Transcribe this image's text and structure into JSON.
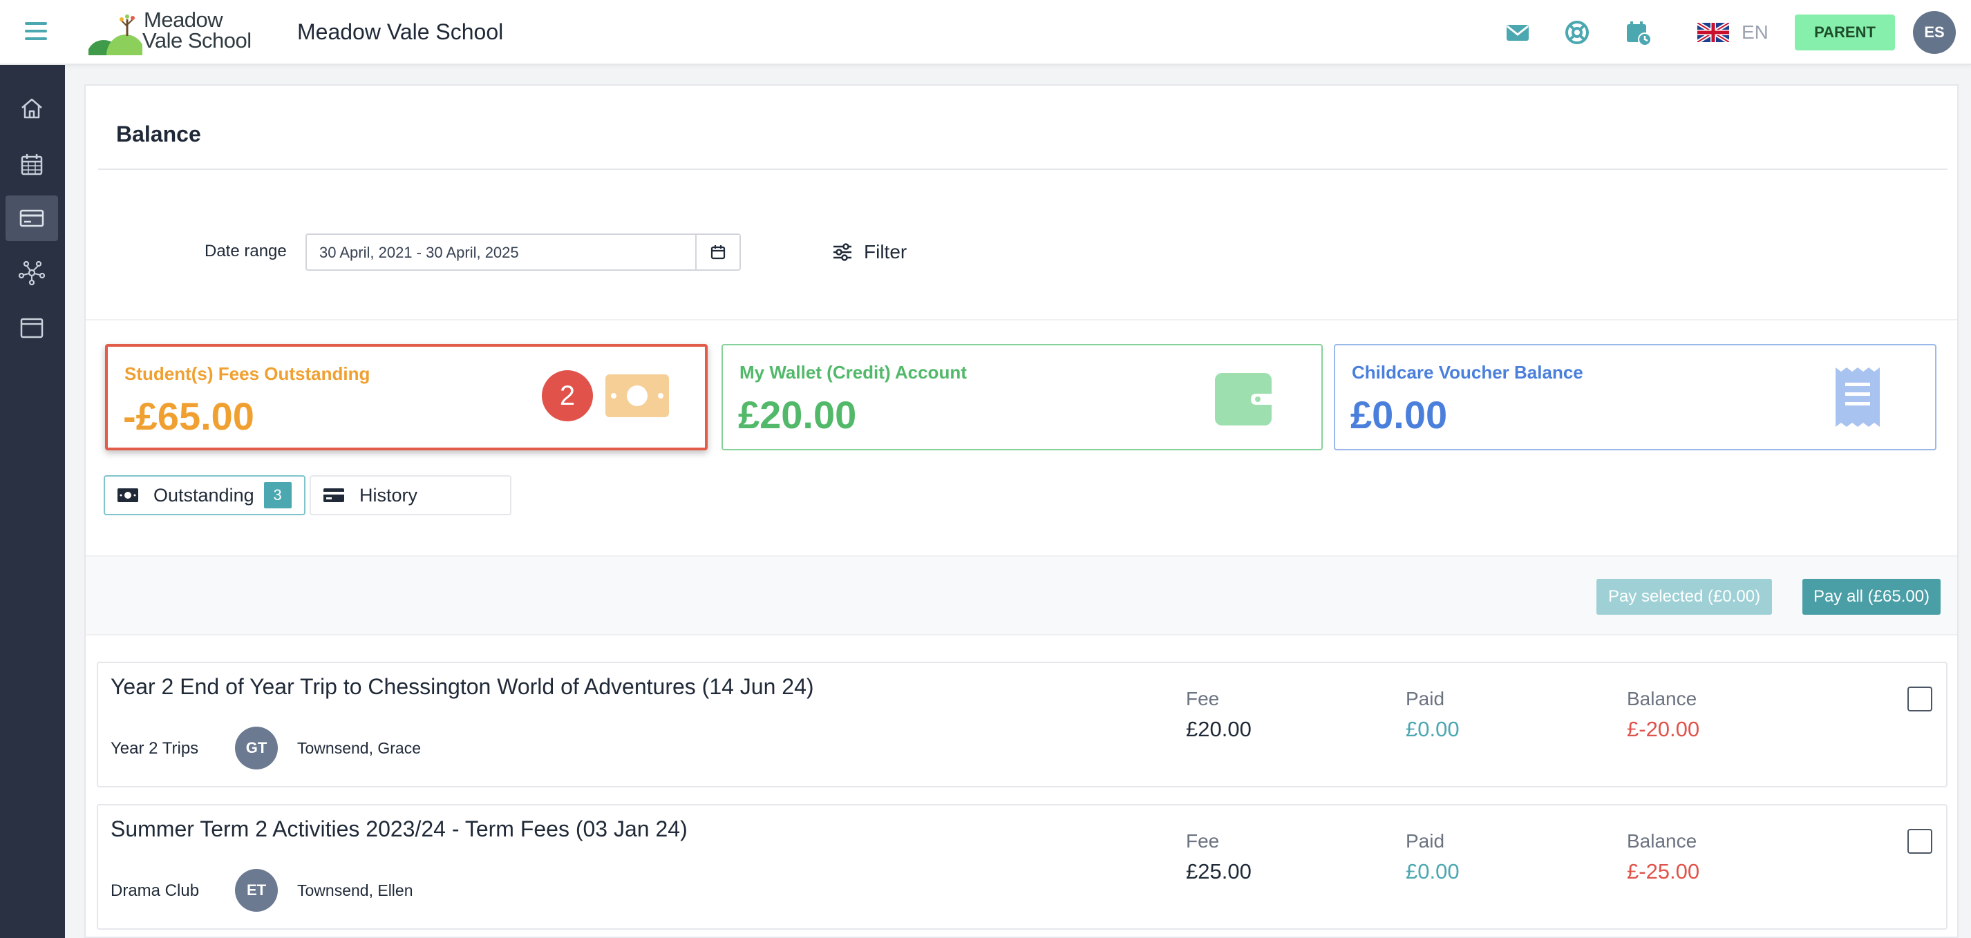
{
  "header": {
    "logo_line1": "Meadow",
    "logo_line2": "Vale School",
    "school_name": "Meadow Vale School",
    "icons": [
      "envelope-icon",
      "lifebuoy-icon",
      "calendar-clock-icon"
    ],
    "language_code": "EN",
    "role_label": "PARENT",
    "user_initials": "ES"
  },
  "sidebar": {
    "items": [
      {
        "icon": "home-icon",
        "active": false
      },
      {
        "icon": "calendar-icon",
        "active": false
      },
      {
        "icon": "card-icon",
        "active": true
      },
      {
        "icon": "network-icon",
        "active": false
      },
      {
        "icon": "window-icon",
        "active": false
      }
    ]
  },
  "page": {
    "title": "Balance",
    "date_range_label": "Date range",
    "date_range_value": "30 April, 2021 - 30 April, 2025",
    "filter_label": "Filter"
  },
  "cards": {
    "fees": {
      "title": "Student(s) Fees Outstanding",
      "value": "-£65.00",
      "step_badge": "2",
      "color": "#f0a030"
    },
    "wallet": {
      "title": "My Wallet (Credit) Account",
      "value": "£20.00",
      "color": "#52b96a"
    },
    "voucher": {
      "title": "Childcare Voucher Balance",
      "value": "£0.00",
      "color": "#4a7fdc"
    }
  },
  "tabs": {
    "outstanding": {
      "label": "Outstanding",
      "count": "3"
    },
    "history": {
      "label": "History"
    }
  },
  "actions": {
    "pay_selected": "Pay selected (£0.00)",
    "pay_all": "Pay all (£65.00)"
  },
  "columns": {
    "fee": "Fee",
    "paid": "Paid",
    "balance": "Balance"
  },
  "fees": [
    {
      "title": "Year 2 End of Year Trip to Chessington World of Adventures (14 Jun 24)",
      "category": "Year 2 Trips",
      "student_initials": "GT",
      "student_name": "Townsend, Grace",
      "fee": "£20.00",
      "paid": "£0.00",
      "balance": "£-20.00"
    },
    {
      "title": "Summer Term 2 Activities 2023/24 - Term Fees (03 Jan 24)",
      "category": "Drama Club",
      "student_initials": "ET",
      "student_name": "Townsend, Ellen",
      "fee": "£25.00",
      "paid": "£0.00",
      "balance": "£-25.00"
    }
  ]
}
